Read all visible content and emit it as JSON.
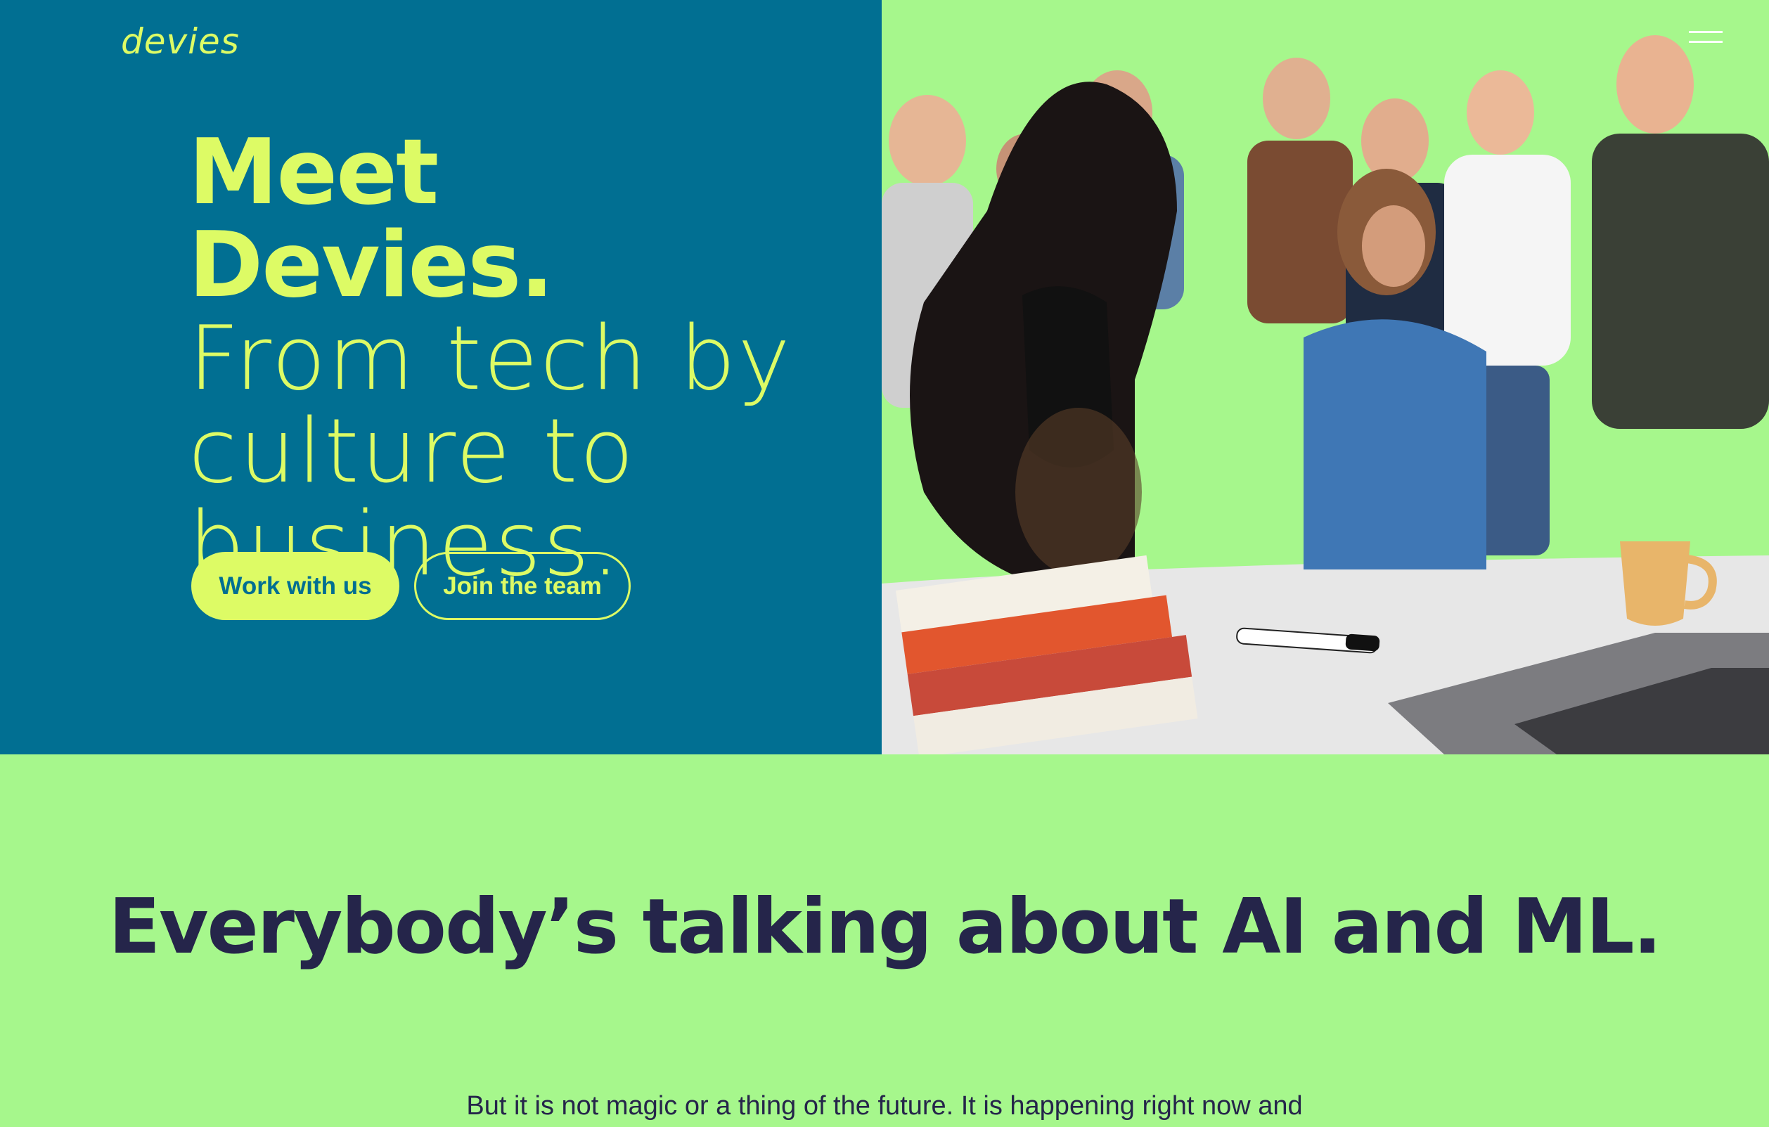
{
  "header": {
    "logo": "devies"
  },
  "hero": {
    "headline_strong": "Meet Devies.",
    "headline_light": "From tech by culture to business.",
    "buttons": {
      "work": "Work with us",
      "join": "Join the team"
    },
    "photo_description_icon": "team-photo"
  },
  "section2": {
    "title": "Everybody’s talking about AI and ML.",
    "body": "But it is not magic or a thing of the future. It is happening right now and"
  },
  "colors": {
    "hero_left_bg": "#016f92",
    "accent_lime": "#ddfb65",
    "light_green": "#a6f78c",
    "dark_navy": "#25254a"
  }
}
